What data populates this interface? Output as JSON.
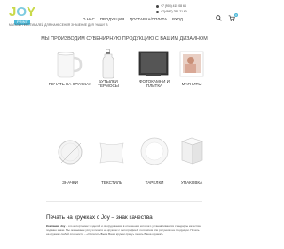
{
  "header": {
    "logo_text_j": "J",
    "logo_text_o": "O",
    "logo_text_y": "Y",
    "logo_badge": "PRINT",
    "tagline": "МАГАЗИН ФЕСТИВАЛЕЙ ДЛЯ НАНЕСЕНИЯ ЗНАЧЕНИЕ ДЛЯ 'НАШИ' В",
    "nav": [
      "О НАС",
      "ПРОДУКЦИЯ",
      "ДОСТАВКА/ОПЛАТА",
      "ВХОД"
    ],
    "phones": [
      "+7 (905) 415 08 64",
      "+7(4967) 251 21 60"
    ],
    "cart_count": "0"
  },
  "main": {
    "heading": "МЫ ПРОИЗВОДИМ СУВЕНИРНУЮ ПРОДУКЦИЮ С ВАШИМ ДИЗАЙНОМ",
    "products": [
      {
        "label": "ПЕЧАТЬ НА КРУЖКАХ"
      },
      {
        "label_1": "БУТЫЛКИ",
        "label_2": "ТЕРМОСЫ"
      },
      {
        "label_1": "ФОТОКАМНИ И",
        "label_2": "ПЛИТКА"
      },
      {
        "label": "МАГНИТЫ"
      },
      {
        "label": "ЗНАЧКИ"
      },
      {
        "label": "ТЕКСТИЛЬ"
      },
      {
        "label": "ТАРЕЛКИ"
      },
      {
        "label": "УПАКОВКА"
      }
    ]
  },
  "about": {
    "title_main": "Печать на кружках с Joy – знак качества",
    "paragraph_lead": "Компания Joy",
    "paragraph_rest": " – это ассортимент изделий и оборудования, в отношении которого устанавливаются стандарты качества под ваш заказ. Мы оказываем услуги печати на кружках с фотографией, логотипом или рисунком на продукции. Печать на кружках любой сложности – «Оплатить/Бьём Ваши кружки сразу» печать Ваша кружка!»"
  },
  "colors": {
    "accent": "#4bb8d8",
    "logo_yellow": "#c9d94a"
  }
}
